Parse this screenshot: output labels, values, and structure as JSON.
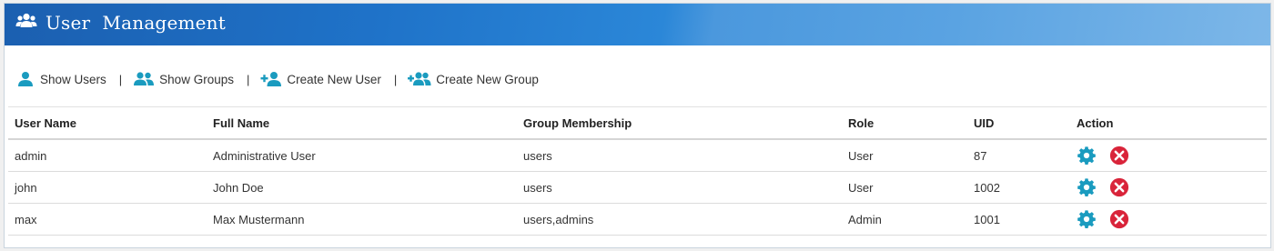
{
  "header": {
    "icon": "users-group-icon",
    "title": "User  Management"
  },
  "toolbar": {
    "items": [
      {
        "label": "Show Users",
        "icon": "user-icon"
      },
      {
        "label": "Show Groups",
        "icon": "users-icon"
      },
      {
        "label": "Create New User",
        "icon": "user-plus-icon"
      },
      {
        "label": "Create New Group",
        "icon": "group-plus-icon"
      }
    ],
    "separator": "|"
  },
  "table": {
    "columns": [
      "User Name",
      "Full Name",
      "Group Membership",
      "Role",
      "UID",
      "Action"
    ],
    "rows": [
      {
        "user_name": "admin",
        "full_name": "Administrative User",
        "groups": "users",
        "role": "User",
        "uid": "87"
      },
      {
        "user_name": "john",
        "full_name": "John Doe",
        "groups": "users",
        "role": "User",
        "uid": "1002"
      },
      {
        "user_name": "max",
        "full_name": "Max Mustermann",
        "groups": "users,admins",
        "role": "Admin",
        "uid": "1001"
      }
    ],
    "actions": {
      "edit_icon": "gear-icon",
      "delete_icon": "delete-icon"
    }
  },
  "colors": {
    "header_start": "#1b5fb0",
    "header_end": "#7db7e8",
    "toolbar_icon": "#1a9bbf",
    "gear": "#1a9bbf",
    "delete": "#d9243a"
  }
}
